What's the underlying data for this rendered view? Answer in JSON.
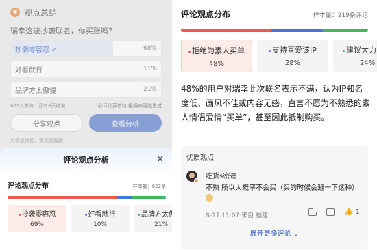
{
  "colors": {
    "red": "#ea5a52",
    "blue": "#3f7bd6",
    "green": "#3fb860",
    "accent": "#2f5cc4"
  },
  "left_poll": {
    "title": "观点总结",
    "question": "瑞幸这波抄袭联名，你买账吗？",
    "options": [
      {
        "label": "抄袭零容忍",
        "percent": "68%",
        "selected": true,
        "fill": 0.68
      },
      {
        "label": "好看就行",
        "percent": "11%",
        "selected": false,
        "fill": 0.11
      },
      {
        "label": "品牌方太傲慢",
        "percent": "21%",
        "selected": false,
        "fill": 0.21
      }
    ],
    "participants": "622人参与 · 还有6天结束",
    "ai_note": "@评论萝伯特 根据AI智能生成",
    "share_button": "分享观点",
    "analyze_button": "查看分析",
    "tip": "点赞是美德，赞赏是鼓励"
  },
  "sheet": {
    "title": "评论观点分析",
    "close_icon": "close-icon",
    "section_title": "评论观点分布",
    "sample": "样本量：622条",
    "cards": [
      {
        "label": "抄袭零容忍",
        "percent": "69%"
      },
      {
        "label": "好看就行",
        "percent": "10%"
      },
      {
        "label": "品牌方太傲慢",
        "percent": "21%"
      }
    ]
  },
  "right": {
    "section_title": "评论观点分布",
    "sample": "样本量：219条评论",
    "cards": [
      {
        "label": "拒绝为素人买单",
        "percent": "48%"
      },
      {
        "label": "支持喜爱该IP",
        "percent": "28%"
      },
      {
        "label": "建议大力",
        "percent": "24%"
      }
    ],
    "description": "48%的用户对瑞幸此次联名表示不满，认为IP知名度低、画风不佳或内容无感，直言不愿为不熟悉的素人情侣爱情“买单”，甚至因此抵制购买。",
    "quote": {
      "label": "优质观点",
      "author": "吃货s密達",
      "text": "不熟 所以大概率不会买（买的时候会避一下这种）",
      "meta": "8-17 11:07 来自 福建",
      "likes": "1",
      "more": "展开更多评论"
    }
  }
}
